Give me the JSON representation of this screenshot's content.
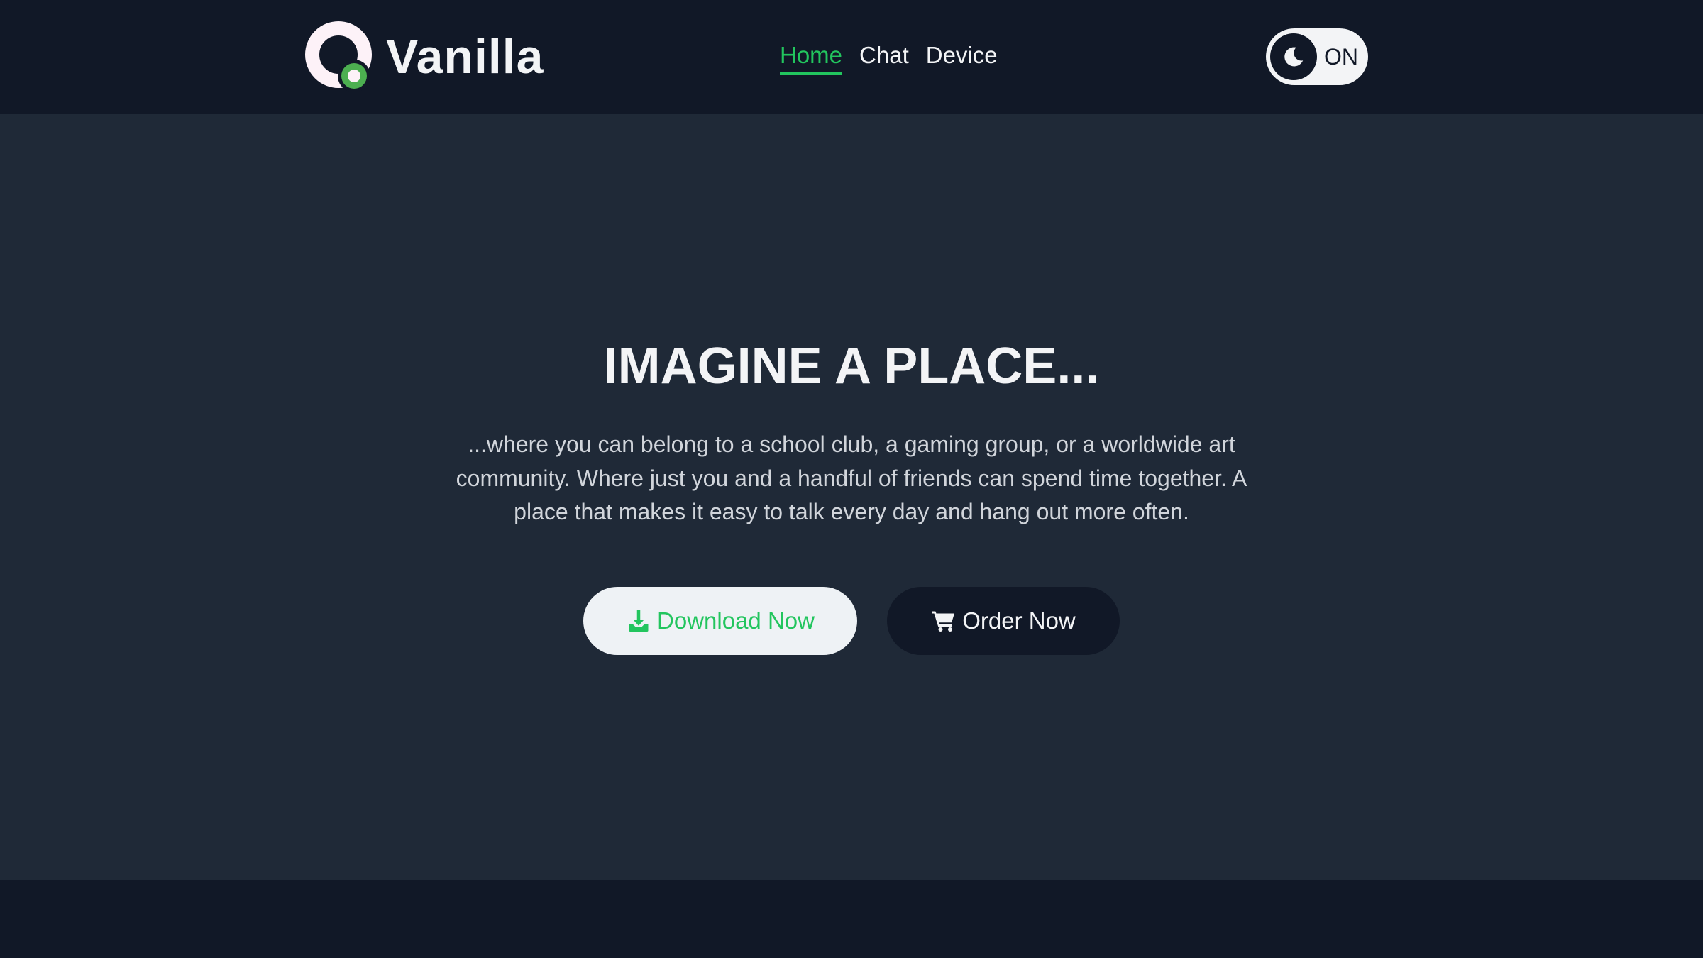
{
  "header": {
    "brand": "Vanilla",
    "nav": [
      {
        "label": "Home",
        "active": true
      },
      {
        "label": "Chat",
        "active": false
      },
      {
        "label": "Device",
        "active": false
      }
    ],
    "theme_toggle": {
      "label": "ON",
      "icon": "moon-icon"
    }
  },
  "hero": {
    "title": "IMAGINE A PLACE...",
    "text": "...where you can belong to a school club, a gaming group, or a worldwide art community. Where just you and a handful of friends can spend time together. A place that makes it easy to talk every day and hang out more often.",
    "buttons": {
      "download": {
        "label": "Download Now",
        "icon": "download-icon"
      },
      "order": {
        "label": "Order Now",
        "icon": "cart-icon"
      }
    }
  },
  "colors": {
    "accent": "#22c55e",
    "header_bg": "#111827",
    "hero_bg": "#1f2937",
    "text_light": "#f3f4f6",
    "logo_ring": "#fdf2f8"
  }
}
